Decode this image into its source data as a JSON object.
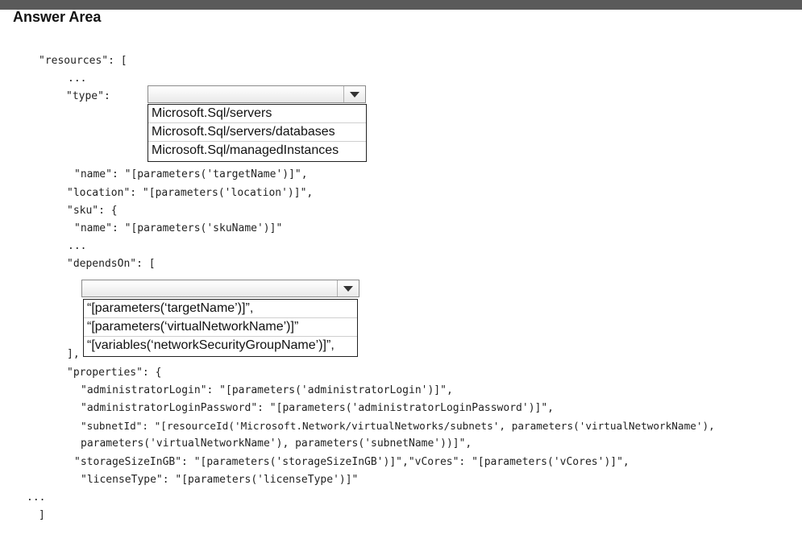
{
  "header": {
    "title": "Answer Area"
  },
  "code": {
    "l01": "\"resources\": [",
    "l02": "...",
    "l03": "\"type\":",
    "l04": "\"name\": \"[parameters('targetName')]\",",
    "l05": "\"location\": \"[parameters('location')]\",",
    "l06": "\"sku\": {",
    "l07": "\"name\": \"[parameters('skuName')]\"",
    "l08": "...",
    "l09": "\"dependsOn\": [",
    "l10": "],",
    "l11": "\"properties\": {",
    "l12": "\"administratorLogin\": \"[parameters('administratorLogin')]\",",
    "l13": "\"administratorLoginPassword\": \"[parameters('administratorLoginPassword')]\",",
    "l14": "\"subnetId\": \"[resourceId('Microsoft.Network/virtualNetworks/subnets', parameters('virtualNetworkName'),",
    "l15": "parameters('virtualNetworkName'), parameters('subnetName'))]\",",
    "l16": "\"storageSizeInGB\": \"[parameters('storageSizeInGB')]\",\"vCores\": \"[parameters('vCores')]\",",
    "l17": "\"licenseType\": \"[parameters('licenseType')]\"",
    "l18": "...",
    "l19": "]"
  },
  "type_dropdown": {
    "selected": "",
    "options": [
      "Microsoft.Sql/servers",
      "Microsoft.Sql/servers/databases",
      "Microsoft.Sql/managedInstances"
    ]
  },
  "depends_dropdown": {
    "selected": "",
    "options": [
      "“[parameters(‘targetName’)]”,",
      "“[parameters(‘virtualNetworkName’)]”",
      "“[variables(‘networkSecurityGroupName’)]”,"
    ]
  }
}
